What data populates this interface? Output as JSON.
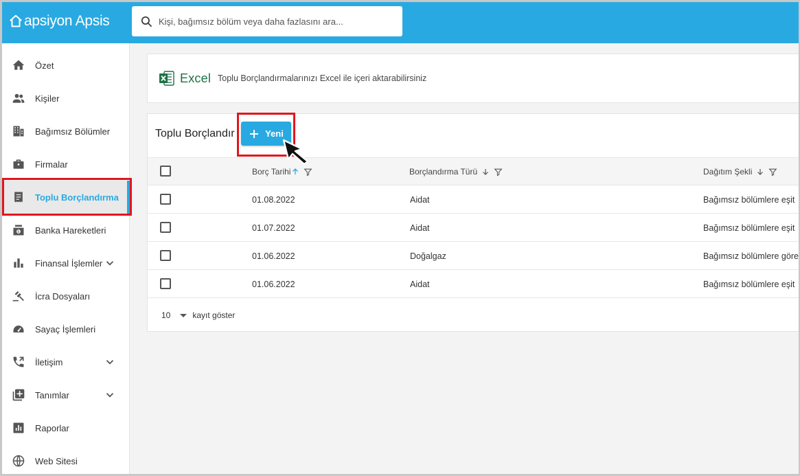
{
  "app": {
    "logo_text": "apsiyon Apsis",
    "search_placeholder": "Kişi, bağımsız bölüm veya daha fazlasını ara..."
  },
  "sidebar": {
    "items": [
      {
        "label": "Özet",
        "icon": "home-icon"
      },
      {
        "label": "Kişiler",
        "icon": "people-icon"
      },
      {
        "label": "Bağımsız Bölümler",
        "icon": "building-icon"
      },
      {
        "label": "Firmalar",
        "icon": "briefcase-icon"
      },
      {
        "label": "Toplu Borçlandırma",
        "icon": "receipt-icon",
        "active": true
      },
      {
        "label": "Banka Hareketleri",
        "icon": "bank-icon"
      },
      {
        "label": "Finansal İşlemler",
        "icon": "bar-chart-icon",
        "expandable": true
      },
      {
        "label": "İcra Dosyaları",
        "icon": "gavel-icon"
      },
      {
        "label": "Sayaç İşlemleri",
        "icon": "meter-icon"
      },
      {
        "label": "İletişim",
        "icon": "phone-icon",
        "expandable": true
      },
      {
        "label": "Tanımlar",
        "icon": "library-add-icon",
        "expandable": true
      },
      {
        "label": "Raporlar",
        "icon": "report-icon"
      },
      {
        "label": "Web Sitesi",
        "icon": "globe-icon"
      }
    ]
  },
  "excel_card": {
    "title": "Excel",
    "description": "Toplu Borçlandırmalarınızı Excel ile içeri aktarabilirsiniz"
  },
  "table_card": {
    "title": "Toplu Borçlandır",
    "new_button": "Yeni",
    "columns": [
      "Borç Tarihi",
      "Borçlandırma Türü",
      "Dağıtım Şekli"
    ],
    "rows": [
      {
        "date": "01.08.2022",
        "type": "Aidat",
        "distribution": "Bağımsız bölümlere eşit"
      },
      {
        "date": "01.07.2022",
        "type": "Aidat",
        "distribution": "Bağımsız bölümlere eşit"
      },
      {
        "date": "01.06.2022",
        "type": "Doğalgaz",
        "distribution": "Bağımsız bölümlere göre"
      },
      {
        "date": "01.06.2022",
        "type": "Aidat",
        "distribution": "Bağımsız bölümlere eşit"
      }
    ],
    "page_size": "10",
    "page_size_label": "kayıt göster"
  },
  "colors": {
    "accent": "#29a9e1",
    "highlight": "#e0161d",
    "excel_green": "#1e7145"
  }
}
